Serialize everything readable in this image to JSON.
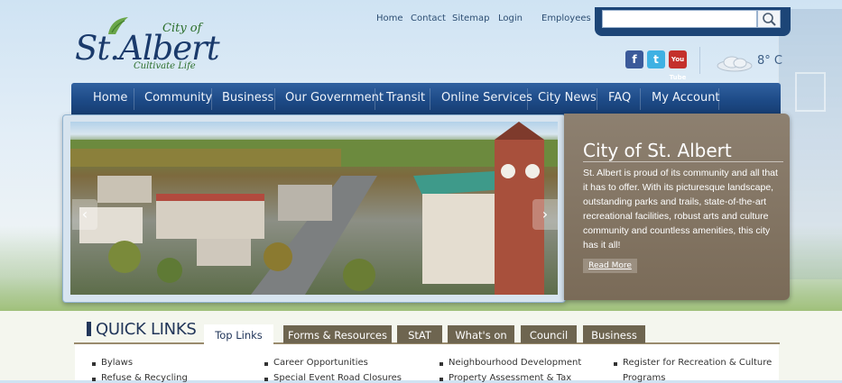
{
  "logo": {
    "city_of": "City of",
    "name": "St.Albert",
    "tagline": "Cultivate Life"
  },
  "utility_nav": [
    "Home",
    "Contact",
    "Sitemap",
    "Login",
    "Employees"
  ],
  "search": {
    "placeholder": "",
    "value": "",
    "icon": "search-icon"
  },
  "social": {
    "facebook": "f",
    "twitter": "t",
    "youtube": "You Tube"
  },
  "weather": {
    "icon": "cloud-icon",
    "temperature": "8° C"
  },
  "main_nav": [
    "Home",
    "Community",
    "Business",
    "Our Government",
    "Transit",
    "Online Services",
    "City News",
    "FAQ",
    "My Account"
  ],
  "slider": {
    "prev_icon": "chevron-left-icon",
    "next_icon": "chevron-right-icon"
  },
  "feature": {
    "title": "City of St. Albert",
    "text": "St. Albert is proud of its community and all that it has to offer. With its picturesque landscape, outstanding parks and trails, state-of-the-art recreational facilities, robust arts and culture community and countless amenities, this city has it all!",
    "more": "Read More"
  },
  "quick_links": {
    "title": "QUICK LINKS",
    "tabs": [
      "Top Links",
      "Forms & Resources",
      "StAT",
      "What's on",
      "Council",
      "Business"
    ],
    "active_tab": "Top Links",
    "columns": [
      [
        "Bylaws",
        "Refuse & Recycling"
      ],
      [
        "Career Opportunities",
        "Special Event Road Closures"
      ],
      [
        "Neighbourhood Development",
        "Property Assessment & Tax"
      ],
      [
        "Register for Recreation & Culture",
        "Programs"
      ]
    ]
  },
  "colors": {
    "nav_blue": "#1d4a86",
    "tab_brown": "#6e6550",
    "feature_brown": "#7a6b58"
  }
}
